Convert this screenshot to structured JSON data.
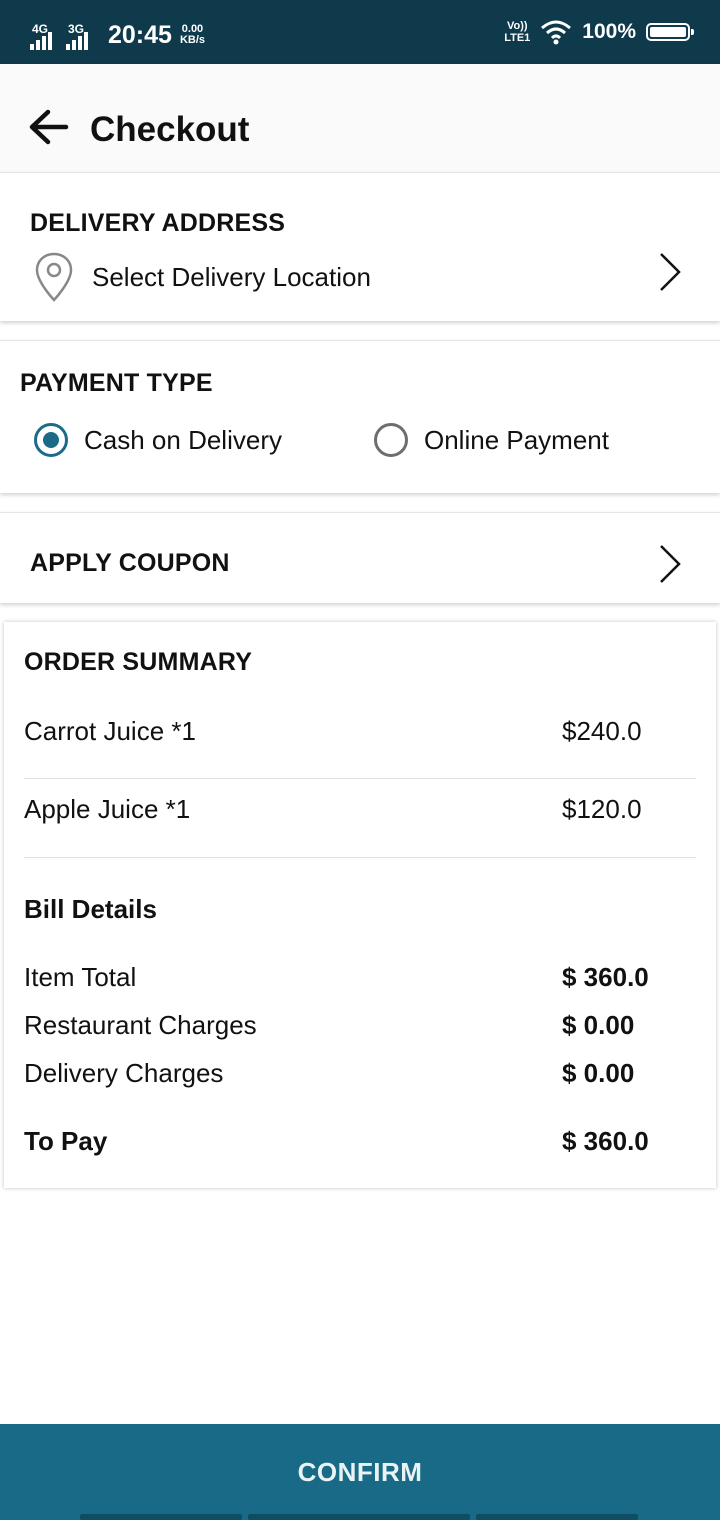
{
  "status_bar": {
    "network1": "4G",
    "network2": "3G",
    "time": "20:45",
    "speed_value": "0.00",
    "speed_unit": "KB/s",
    "volte_top": "Vo))",
    "volte_bottom": "LTE1",
    "battery": "100%"
  },
  "header": {
    "title": "Checkout"
  },
  "delivery": {
    "section_title": "DELIVERY ADDRESS",
    "location_label": "Select Delivery Location"
  },
  "payment": {
    "section_title": "PAYMENT TYPE",
    "options": [
      {
        "label": "Cash on Delivery",
        "selected": true
      },
      {
        "label": "Online Payment",
        "selected": false
      }
    ]
  },
  "coupon": {
    "label": "APPLY COUPON"
  },
  "order_summary": {
    "section_title": "ORDER SUMMARY",
    "items": [
      {
        "name": "Carrot Juice *1",
        "price": "$240.0"
      },
      {
        "name": "Apple Juice *1",
        "price": "$120.0"
      }
    ]
  },
  "bill": {
    "title": "Bill Details",
    "item_total_label": "Item Total",
    "item_total_value": "$ 360.0",
    "restaurant_label": "Restaurant Charges",
    "restaurant_value": "$ 0.00",
    "delivery_label": "Delivery Charges",
    "delivery_value": "$ 0.00",
    "to_pay_label": "To Pay",
    "to_pay_value": "$ 360.0"
  },
  "footer": {
    "confirm_label": "CONFIRM"
  },
  "colors": {
    "status_bar_bg": "#0e3a4c",
    "accent": "#1b6b88",
    "confirm_bg": "#186a87"
  }
}
